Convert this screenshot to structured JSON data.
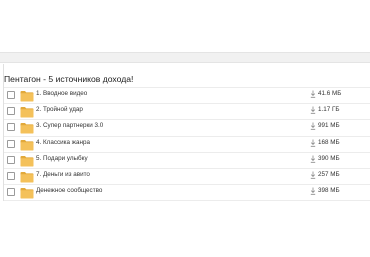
{
  "folder_title": "Пентагон - 5 источников дохода!",
  "download_icon": "download-arrow-icon",
  "folder_icon": "folder-icon",
  "colors": {
    "folder": "#f4c15a",
    "folder_dark": "#e2a93a"
  },
  "items": [
    {
      "name": "1. Вводное видео",
      "size": "41.6 МБ"
    },
    {
      "name": "2. Тройной удар",
      "size": "1.17 ГБ"
    },
    {
      "name": "3. Супер партнерки 3.0",
      "size": "991 МБ"
    },
    {
      "name": "4. Классика жанра",
      "size": "168 МБ"
    },
    {
      "name": "5. Подари улыбку",
      "size": "390 МБ"
    },
    {
      "name": "7. Деньги из авито",
      "size": "257 МБ"
    },
    {
      "name": "Денежное сообщество",
      "size": "398 МБ"
    }
  ]
}
